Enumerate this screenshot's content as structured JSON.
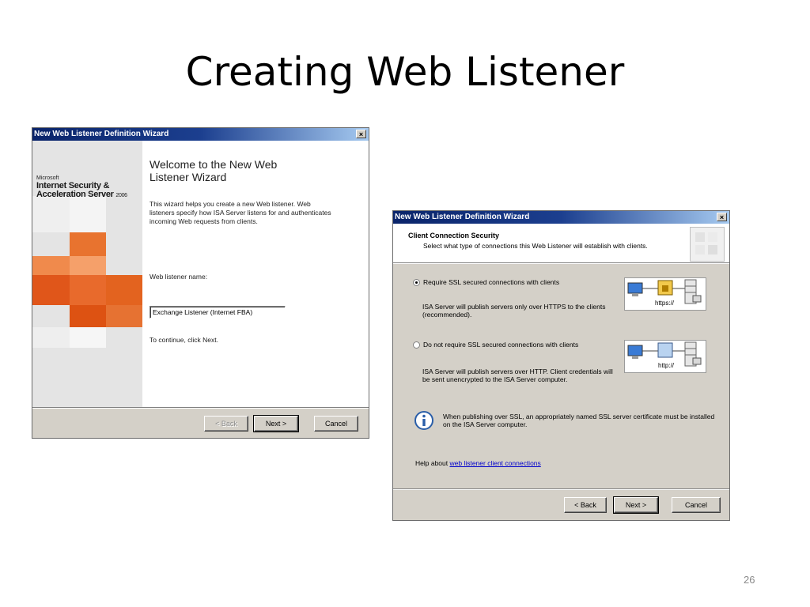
{
  "slide": {
    "title": "Creating Web Listener",
    "page_number": "26"
  },
  "dialog1": {
    "title": "New Web Listener Definition Wizard",
    "close": "×",
    "brand_small": "Microsoft",
    "brand_line1": "Internet Security &",
    "brand_line2": "Acceleration Server",
    "brand_year": "2006",
    "heading_line1": "Welcome to the New Web",
    "heading_line2": "Listener Wizard",
    "description": "This wizard helps you create a new Web listener. Web listeners specify how ISA Server listens for and authenticates incoming Web requests from clients.",
    "name_label": "Web listener name:",
    "name_value": "Exchange Listener (Internet FBA)",
    "continue_text": "To continue, click Next.",
    "buttons": {
      "back": "< Back",
      "next": "Next >",
      "cancel": "Cancel"
    }
  },
  "dialog2": {
    "title": "New Web Listener Definition Wizard",
    "close": "×",
    "header_title": "Client Connection Security",
    "header_subtitle": "Select what type of connections this Web Listener will establish with clients.",
    "option1_label": "Require SSL secured connections with clients",
    "option1_desc": "ISA Server will publish servers only over HTTPS to the clients (recommended).",
    "option1_diagram": "https://",
    "option2_label": "Do not require SSL secured connections with clients",
    "option2_desc": "ISA Server will publish servers over HTTP. Client credentials will be sent unencrypted to the ISA Server computer.",
    "option2_diagram": "http://",
    "info_text": "When publishing over SSL, an appropriately named SSL server certificate must be installed on the ISA Server computer.",
    "help_prefix": "Help about ",
    "help_link": "web listener client connections",
    "buttons": {
      "back": "< Back",
      "next": "Next >",
      "cancel": "Cancel"
    }
  },
  "colors": {
    "titlebar": "#0a246a",
    "dialog_face": "#d4d0c8",
    "orange_accent": "#e3631f"
  }
}
